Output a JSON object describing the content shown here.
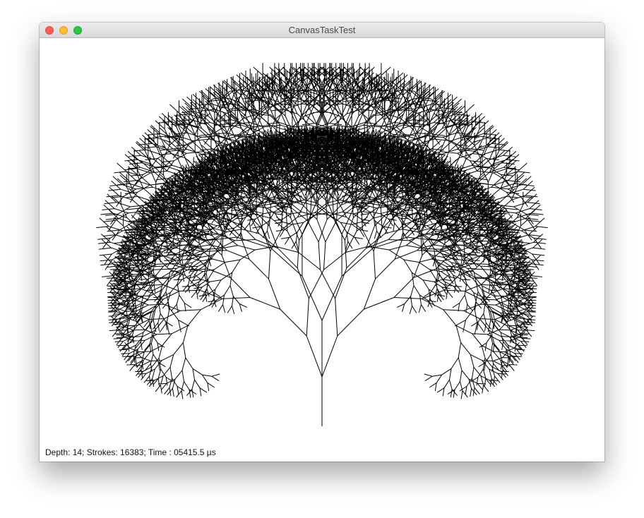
{
  "window": {
    "title": "CanvasTaskTest",
    "controls": {
      "close_icon": "close-icon",
      "minimize_icon": "minimize-icon",
      "zoom_icon": "zoom-icon",
      "close_color": "#fc5f57",
      "minimize_color": "#fdbc2e",
      "zoom_color": "#28c840"
    }
  },
  "canvas": {
    "drawing": "fractal-tree",
    "stroke_color": "#000000",
    "background_color": "#ffffff"
  },
  "status": {
    "text": "Depth: 14; Strokes: 16383; Time : 05415.5 µs"
  }
}
